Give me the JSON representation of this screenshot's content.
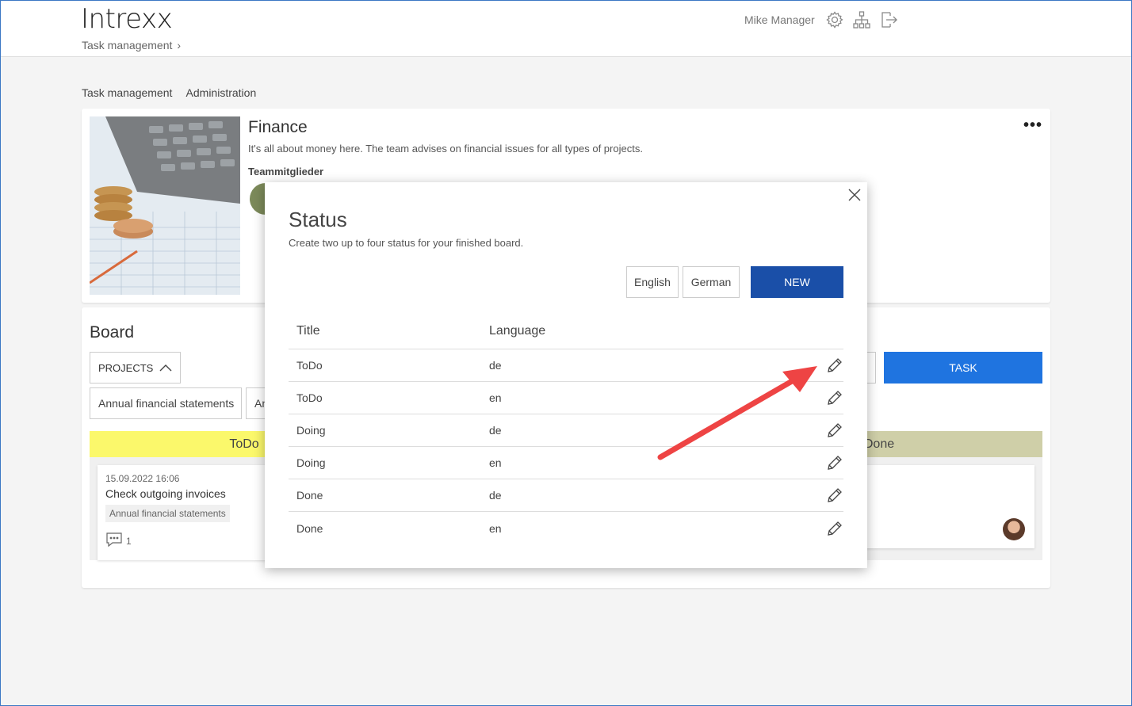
{
  "header": {
    "logo": "Intrexx",
    "breadcrumb": "Task management",
    "user_name": "Mike Manager"
  },
  "subnav": {
    "items": [
      "Task management",
      "Administration"
    ]
  },
  "team": {
    "title": "Finance",
    "description": "It's all about money here. The team advises on financial issues for all types of projects.",
    "members_label": "Teammitglieder",
    "more_label": "•••"
  },
  "board": {
    "title": "Board",
    "projects_label": "PROJECTS",
    "chips": [
      "Annual financial statements",
      "An"
    ],
    "task_button": "TASK",
    "columns": {
      "todo": "ToDo",
      "done": "Done"
    },
    "card": {
      "date": "15.09.2022 16:06",
      "title": "Check outgoing invoices",
      "tag": "Annual financial statements",
      "comment_count": "1"
    }
  },
  "dialog": {
    "title": "Status",
    "description": "Create two up to four status for your finished board.",
    "btn_english": "English",
    "btn_german": "German",
    "btn_new": "NEW",
    "col_title": "Title",
    "col_language": "Language",
    "rows": [
      {
        "title": "ToDo",
        "language": "de"
      },
      {
        "title": "ToDo",
        "language": "en"
      },
      {
        "title": "Doing",
        "language": "de"
      },
      {
        "title": "Doing",
        "language": "en"
      },
      {
        "title": "Done",
        "language": "de"
      },
      {
        "title": "Done",
        "language": "en"
      }
    ]
  },
  "colors": {
    "primary": "#1a4fa8",
    "task_button": "#1f74e0",
    "todo_column": "#fbf86b",
    "done_column": "#cfcfa8",
    "annotation_arrow": "#ee4444"
  }
}
